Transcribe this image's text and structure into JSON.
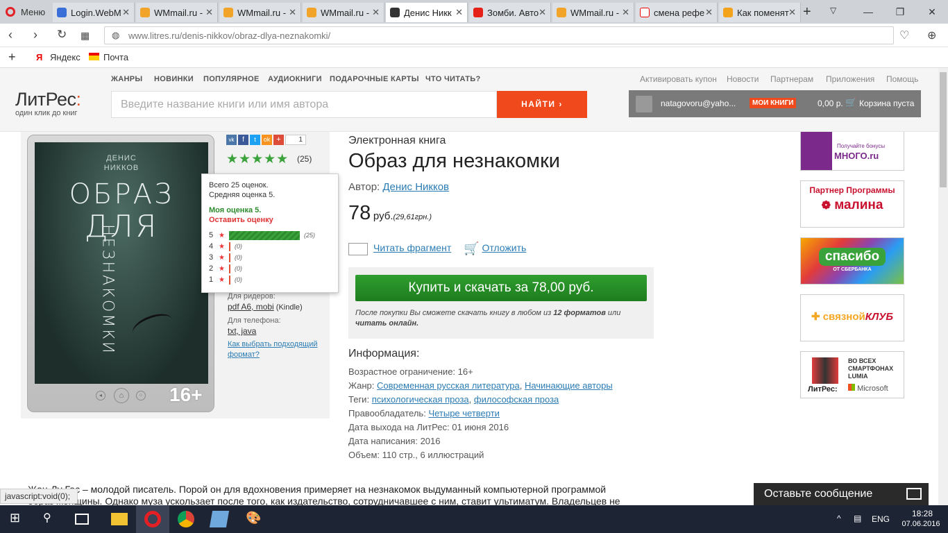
{
  "browser": {
    "menu_label": "Меню",
    "tabs": [
      {
        "title": "Login.WebM",
        "color": "#3a6fd8"
      },
      {
        "title": "WMmail.ru -",
        "color": "#f1a32a"
      },
      {
        "title": "WMmail.ru -",
        "color": "#f1a32a"
      },
      {
        "title": "WMmail.ru -",
        "color": "#f1a32a"
      },
      {
        "title": "Денис Никк",
        "color": "#333333"
      },
      {
        "title": "Зомби. Авто",
        "color": "#e62117"
      },
      {
        "title": "WMmail.ru -",
        "color": "#f1a32a"
      },
      {
        "title": "смена рефе",
        "color": "#ffffff"
      },
      {
        "title": "Как поменят",
        "color": "#f3a21b"
      }
    ],
    "url": "www.litres.ru/denis-nikkov/obraz-dlya-neznakomki/",
    "bookmarks": [
      "Яндекс",
      "Почта"
    ]
  },
  "header": {
    "nav": [
      "ЖАНРЫ",
      "НОВИНКИ",
      "ПОПУЛЯРНОЕ",
      "АУДИОКНИГИ",
      "ПОДАРОЧНЫЕ КАРТЫ",
      "ЧТО ЧИТАТЬ?"
    ],
    "rnav": [
      "Активировать купон",
      "Новости",
      "Партнерам",
      "Приложения",
      "Помощь"
    ],
    "logo_main": "ЛитРес",
    "logo_colon": ":",
    "logo_tag": "один клик до книг",
    "search_placeholder": "Введите название книги или имя автора",
    "find_label": "НАЙТИ  ›",
    "user": "natagovoru@yaho...",
    "mybooks": "МОИ КНИГИ",
    "balance": "0,00 р.",
    "cart": "Корзина пуста"
  },
  "book": {
    "cover_author": "ДЕНИС\nНИККОВ",
    "cover_title_1": "ОБРАЗ",
    "cover_title_2": "ДЛЯ",
    "cover_title_3": "НЕЗНАКОМКИ",
    "age_badge": "16+",
    "share_count": "1",
    "rating_count": "(25)",
    "type": "Электронная книга",
    "title": "Образ для незнакомки",
    "author_label": "Автор:",
    "author": "Денис Никков",
    "price": "78",
    "price_unit": "руб.",
    "price_uah": "(29,61грн.)",
    "read_fragment": "Читать фрагмент",
    "postpone": "Отложить",
    "buy_label": "Купить и скачать за 78,00 руб.",
    "buy_note_1": "После покупки Вы сможете скачать книгу в любом из",
    "buy_note_formats": "12 форматов",
    "buy_note_or": "или",
    "buy_note_online": "читать онлайн."
  },
  "formats": {
    "readers_label": "Для ридеров:",
    "readers": "pdf A6, mobi",
    "kindle": "(Kindle)",
    "phone_label": "Для телефона:",
    "phone": "txt, java",
    "howto": "Как выбрать подходящий формат?"
  },
  "rating_popup": {
    "total": "Всего 25 оценок.",
    "avg": "Средняя оценка 5.",
    "mine": "Моя оценка 5.",
    "leave": "Оставить оценку",
    "rows": [
      {
        "n": "5",
        "count": "(25)",
        "full": true
      },
      {
        "n": "4",
        "count": "(0)",
        "full": false
      },
      {
        "n": "3",
        "count": "(0)",
        "full": false
      },
      {
        "n": "2",
        "count": "(0)",
        "full": false
      },
      {
        "n": "1",
        "count": "(0)",
        "full": false
      }
    ]
  },
  "info": {
    "heading": "Информация:",
    "age_label": "Возрастное ограничение:",
    "age": "16+",
    "genre_label": "Жанр:",
    "genre_1": "Современная русская литература",
    "genre_2": "Начинающие авторы",
    "tags_label": "Теги:",
    "tag_1": "психологическая проза",
    "tag_2": "философская проза",
    "holder_label": "Правообладатель:",
    "holder": "Четыре четверти",
    "release_label": "Дата выхода на ЛитРес:",
    "release": "01 июня 2016",
    "written_label": "Дата написания:",
    "written": "2016",
    "volume_label": "Объем:",
    "volume": "110 стр., 6 иллюстраций"
  },
  "description": {
    "line1": "Жан-Лу Гас – молодой писатель. Порой он для вдохновения примеряет на незнакомок выдуманный компьютерной программой",
    "line2": "образ женщины. Однако муза ускользает после того, как издательство, сотрудничавшее с ним, ставит ультиматум. Владельцев не"
  },
  "ads": {
    "mnogo_small": "Получайте бонусы",
    "mnogo": "МНОГО.ru",
    "malina_top": "Партнер Программы",
    "malina": "малина",
    "spasibo": "спасибо",
    "spasibo_sub": "ОТ СБЕРБАНКА",
    "svyaznoy": "связной",
    "svyaznoy_club": "КЛУБ",
    "lumia": "ВО ВСЕХ СМАРТФОНАХ LUMIA",
    "lumia_ms": "Microsoft",
    "lumia_litres": "ЛитРес:"
  },
  "status": {
    "link": "javascript:void(0);"
  },
  "chat": {
    "label": "Оставьте сообщение"
  },
  "taskbar": {
    "lang": "ENG",
    "time": "18:28",
    "date": "07.06.2016"
  }
}
